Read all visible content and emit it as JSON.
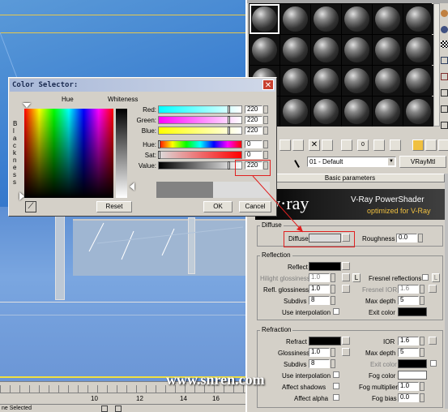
{
  "viewport": {
    "ruler_ticks": [
      "10",
      "12",
      "14",
      "16"
    ],
    "status": "ne Selected"
  },
  "watermark": "www.snren.com",
  "color_dialog": {
    "title": "Color Selector:",
    "hue_label": "Hue",
    "whiteness_label": "Whiteness",
    "blackness_label": "B l a c k n e s s",
    "channels": [
      {
        "label": "Red:",
        "value": "220"
      },
      {
        "label": "Green:",
        "value": "220"
      },
      {
        "label": "Blue:",
        "value": "220"
      },
      {
        "label": "Hue:",
        "value": "0"
      },
      {
        "label": "Sat:",
        "value": "0"
      },
      {
        "label": "Value:",
        "value": "220"
      }
    ],
    "current_color": "#dcdcdc",
    "previous_color": "#828282",
    "reset_label": "Reset",
    "ok_label": "OK",
    "cancel_label": "Cancel"
  },
  "material_editor": {
    "material_name": "01 - Default",
    "material_type": "VRayMtl",
    "rollout_title": "Basic parameters",
    "vray_logo": "v·ray",
    "banner_title": "V-Ray PowerShader",
    "banner_subtitle": "optimized for V-Ray",
    "diffuse": {
      "group": "Diffuse",
      "label": "Diffuse",
      "roughness_label": "Roughness",
      "roughness": "0.0"
    },
    "reflection": {
      "group": "Reflection",
      "reflect_label": "Reflect",
      "hilight_label": "Hilight glossiness",
      "hilight": "1.0",
      "refl_gloss_label": "Refl. glossiness",
      "refl_gloss": "1.0",
      "subdivs_label": "Subdivs",
      "subdivs": "8",
      "interp_label": "Use interpolation",
      "lock": "L",
      "fresnel_label": "Fresnel reflections",
      "fresnel_ior_label": "Fresnel IOR",
      "fresnel_ior": "1.6",
      "max_depth_label": "Max depth",
      "max_depth": "5",
      "exit_color_label": "Exit color"
    },
    "refraction": {
      "group": "Refraction",
      "refract_label": "Refract",
      "ior_label": "IOR",
      "ior": "1.6",
      "gloss_label": "Glossiness",
      "gloss": "1.0",
      "max_depth_label": "Max depth",
      "max_depth": "5",
      "subdivs_label": "Subdivs",
      "subdivs": "8",
      "exit_color_label": "Exit color",
      "interp_label": "Use interpolation",
      "fog_color_label": "Fog color",
      "affect_shadows_label": "Affect shadows",
      "fog_mult_label": "Fog multiplier",
      "fog_mult": "1.0",
      "affect_alpha_label": "Affect alpha",
      "fog_bias_label": "Fog bias",
      "fog_bias": "0.0"
    }
  }
}
